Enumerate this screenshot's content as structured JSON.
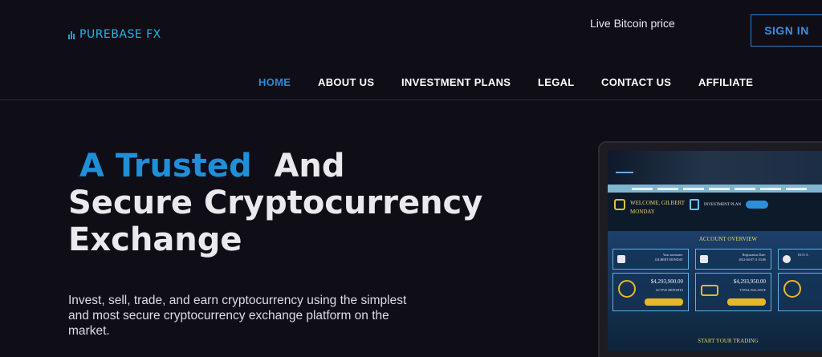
{
  "brand": {
    "name": "PUREBASE FX",
    "logo_icon": "bars-icon",
    "accent": "#1ea0d6"
  },
  "header": {
    "live_price": "Live Bitcoin price",
    "sign_in": "SIGN IN"
  },
  "nav": {
    "items": [
      {
        "label": "HOME",
        "active": true
      },
      {
        "label": "ABOUT US",
        "active": false
      },
      {
        "label": "INVESTMENT PLANS",
        "active": false
      },
      {
        "label": "LEGAL",
        "active": false
      },
      {
        "label": "CONTACT US",
        "active": false
      },
      {
        "label": "AFFILIATE",
        "active": false
      }
    ]
  },
  "hero": {
    "title_accent": "A Trusted",
    "title_rest": "And",
    "title_line2": "Secure Cryptocurrency",
    "title_line3": "Exchange",
    "subtitle": "Invest, sell, trade, and earn cryptocurrency using the simplest and most secure cryptocurrency exchange platform on the market."
  },
  "mockup": {
    "welcome_line1": "WELCOME, GILBERT",
    "welcome_line2": "MONDAY",
    "invest_label": "INVESTMENT PLAN",
    "overview_title": "ACCOUNT OVERVIEW",
    "card1_line1": "Your username:",
    "card1_line2": "GILBERT MONDAY",
    "card2_line1": "Registration Date:",
    "card2_line2": "2022-04-07 11:53:06",
    "card3_line1": "03:51 A",
    "deposit_value": "$4,293,900.00",
    "deposit_label": "ACTIVE DEPOSITS",
    "balance_value": "$4,293,950.00",
    "balance_label": "TOTAL BALANCE",
    "start_trading": "START YOUR TRADING",
    "accent_gold": "#e5b82b"
  },
  "colors": {
    "background": "#0f0e17",
    "nav_active": "#2f8ad8",
    "title_accent": "#1f8fd8"
  }
}
